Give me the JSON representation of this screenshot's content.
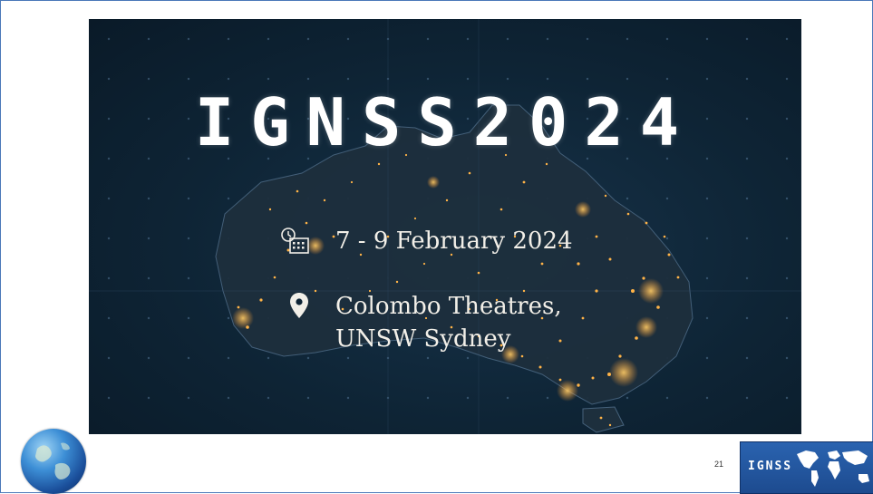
{
  "slide": {
    "title": "IGNSS2024",
    "date": "7 - 9 February 2024",
    "venue_line1": "Colombo Theatres,",
    "venue_line2": "UNSW Sydney",
    "page_number": "21",
    "logo_text": "IGNSS"
  },
  "icons": {
    "date": "calendar-clock-icon",
    "venue": "location-pin-icon"
  },
  "colors": {
    "border": "#4a78b8",
    "banner_bg": "#0e2435",
    "city_lights": "#ffb347",
    "text": "#f2efe8",
    "logo_bg": "#2a63b0"
  }
}
